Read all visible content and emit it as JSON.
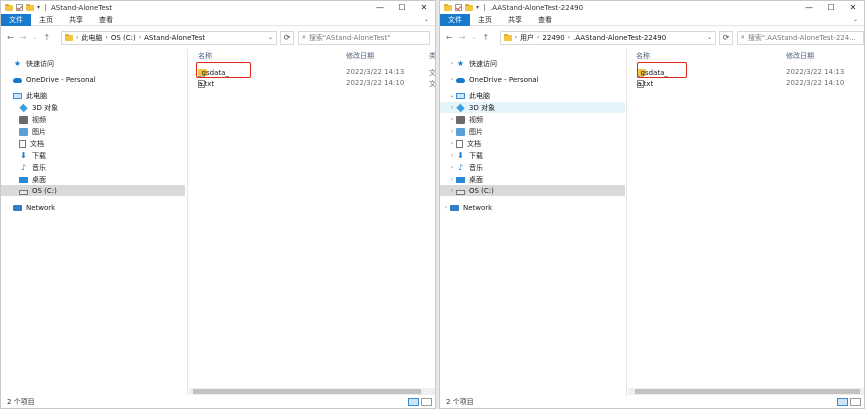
{
  "left": {
    "title": "AStand-AloneTest",
    "ribbon_tabs": [
      "文件",
      "主页",
      "共享",
      "查看"
    ],
    "address": [
      "此电脑",
      "OS (C:)",
      "AStand-AloneTest"
    ],
    "search_placeholder": "搜索\"AStand-AloneTest\"",
    "columns": {
      "name": "名称",
      "modified": "修改日期",
      "type": "类型"
    },
    "rows": [
      {
        "name": "_gsdata_",
        "modified": "2022/3/22 14:13",
        "type": "文件"
      },
      {
        "name": "a.txt",
        "modified": "2022/3/22 14:10",
        "type": "文本"
      }
    ],
    "nav": {
      "quick": "快速访问",
      "onedrive": "OneDrive - Personal",
      "thispc": "此电脑",
      "items": [
        "3D 对象",
        "视频",
        "图片",
        "文档",
        "下载",
        "音乐",
        "桌面",
        "OS (C:)"
      ],
      "network": "Network"
    },
    "status": "2 个项目"
  },
  "right": {
    "title": ".AAStand-AloneTest-22490",
    "ribbon_tabs": [
      "文件",
      "主页",
      "共享",
      "查看"
    ],
    "address": [
      "用户",
      "22490",
      ".AAStand-AloneTest-22490"
    ],
    "search_placeholder": "搜索\".AAStand-AloneTest-224...",
    "columns": {
      "name": "名称",
      "modified": "修改日期"
    },
    "rows": [
      {
        "name": "_gsdata_",
        "modified": "2022/3/22 14:13"
      },
      {
        "name": "a.txt",
        "modified": "2022/3/22 14:10"
      }
    ],
    "nav": {
      "quick": "快速访问",
      "onedrive": "OneDrive - Personal",
      "thispc": "此电脑",
      "items": [
        "3D 对象",
        "视频",
        "图片",
        "文档",
        "下载",
        "音乐",
        "桌面",
        "OS (C:)"
      ],
      "network": "Network"
    },
    "status": "2 个项目"
  },
  "window_buttons": {
    "min": "—",
    "max": "☐",
    "close": "✕"
  },
  "colors": {
    "accent": "#1979ca",
    "highlight_box": "#e0281c",
    "selected_nav": "#d9d9d9"
  }
}
